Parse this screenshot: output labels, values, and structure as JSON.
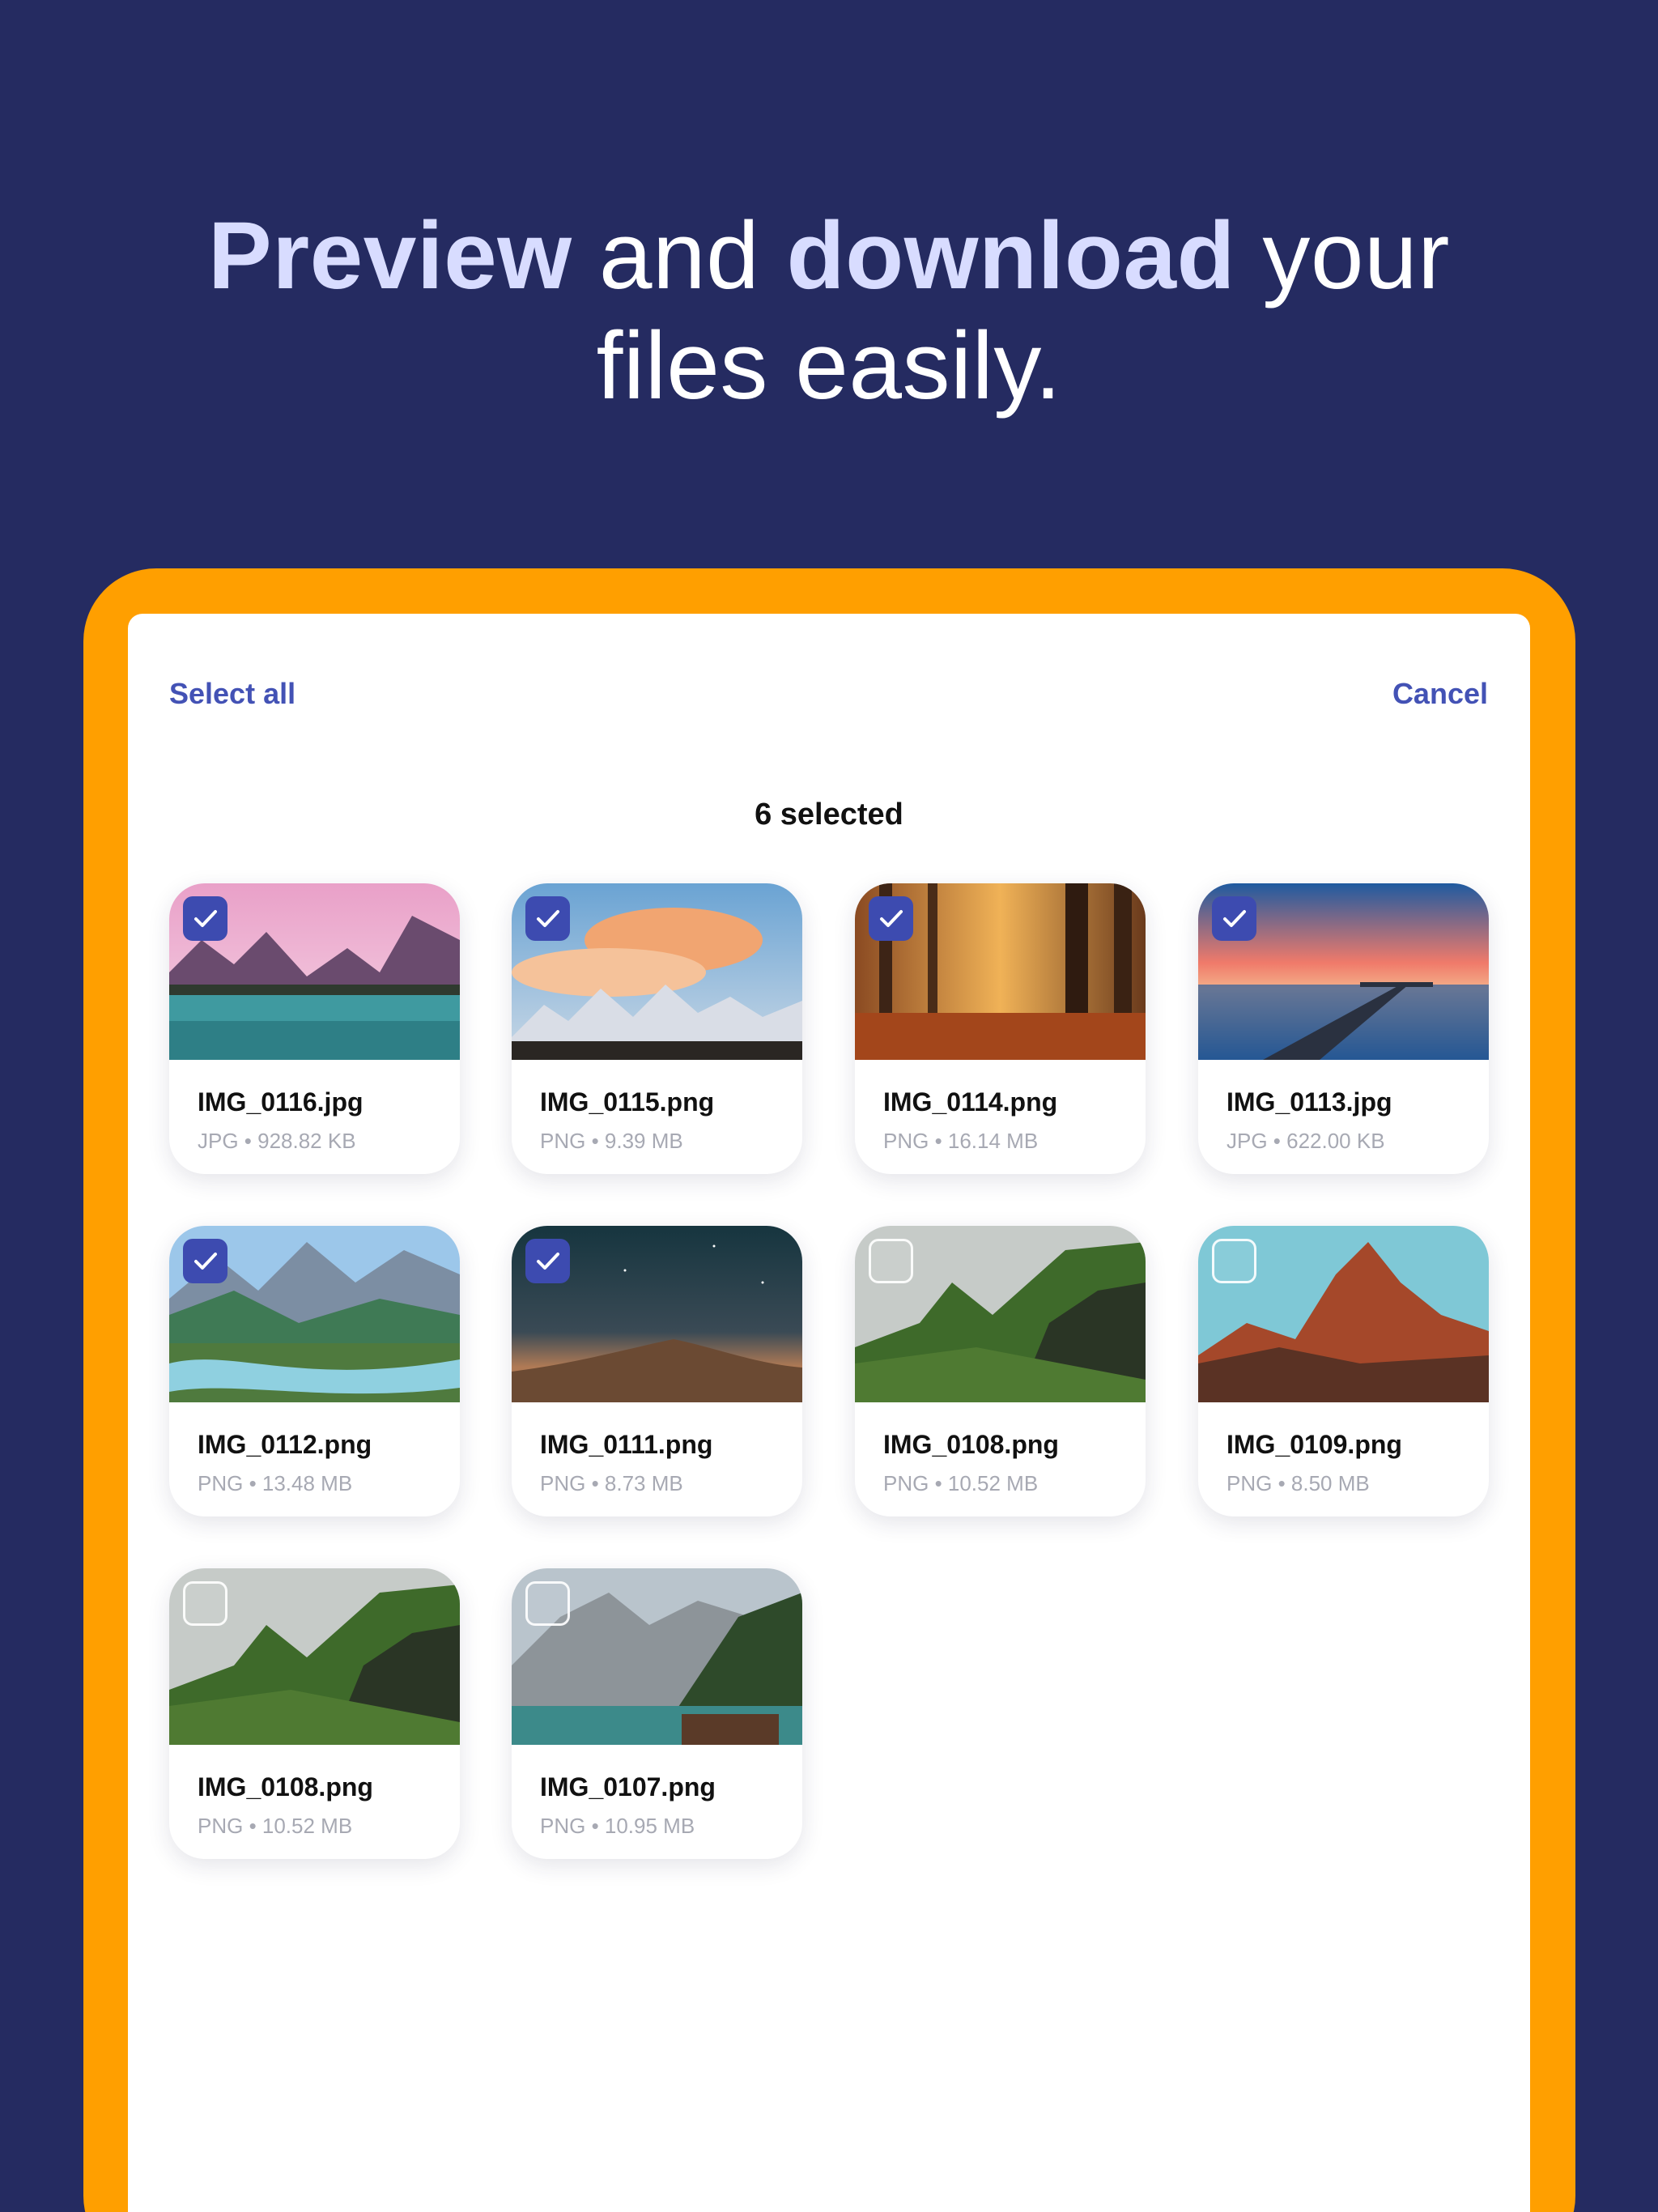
{
  "headline": {
    "part1": "Preview",
    "part2": " and ",
    "part3": "download",
    "part4": " your",
    "line2": "files easily."
  },
  "toolbar": {
    "select_all": "Select all",
    "cancel": "Cancel",
    "selected_count": "6 selected"
  },
  "colors": {
    "background": "#252b61",
    "device_frame": "#ff9f00",
    "accent": "#4352b5",
    "checkbox_selected": "#3d4bb0"
  },
  "files": [
    {
      "name": "IMG_0116.jpg",
      "meta": "JPG • 928.82 KB",
      "selected": true,
      "scene": "pink lake mountains"
    },
    {
      "name": "IMG_0115.png",
      "meta": "PNG • 9.39 MB",
      "selected": true,
      "scene": "sunset clouds over snowy peaks"
    },
    {
      "name": "IMG_0114.png",
      "meta": "PNG • 16.14 MB",
      "selected": true,
      "scene": "autumn forest"
    },
    {
      "name": "IMG_0113.jpg",
      "meta": "JPG • 622.00 KB",
      "selected": true,
      "scene": "pier at sunset"
    },
    {
      "name": "IMG_0112.png",
      "meta": "PNG • 13.48 MB",
      "selected": true,
      "scene": "mountain river"
    },
    {
      "name": "IMG_0111.png",
      "meta": "PNG • 8.73 MB",
      "selected": true,
      "scene": "night sky over hill"
    },
    {
      "name": "IMG_0108.png",
      "meta": "PNG • 10.52 MB",
      "selected": false,
      "scene": "green cliffs"
    },
    {
      "name": "IMG_0109.png",
      "meta": "PNG • 8.50 MB",
      "selected": false,
      "scene": "red rocky peaks"
    },
    {
      "name": "IMG_0108.png",
      "meta": "PNG • 10.52 MB",
      "selected": false,
      "scene": "green cliffs"
    },
    {
      "name": "IMG_0107.png",
      "meta": "PNG • 10.95 MB",
      "selected": false,
      "scene": "alpine lake with cabin"
    }
  ]
}
